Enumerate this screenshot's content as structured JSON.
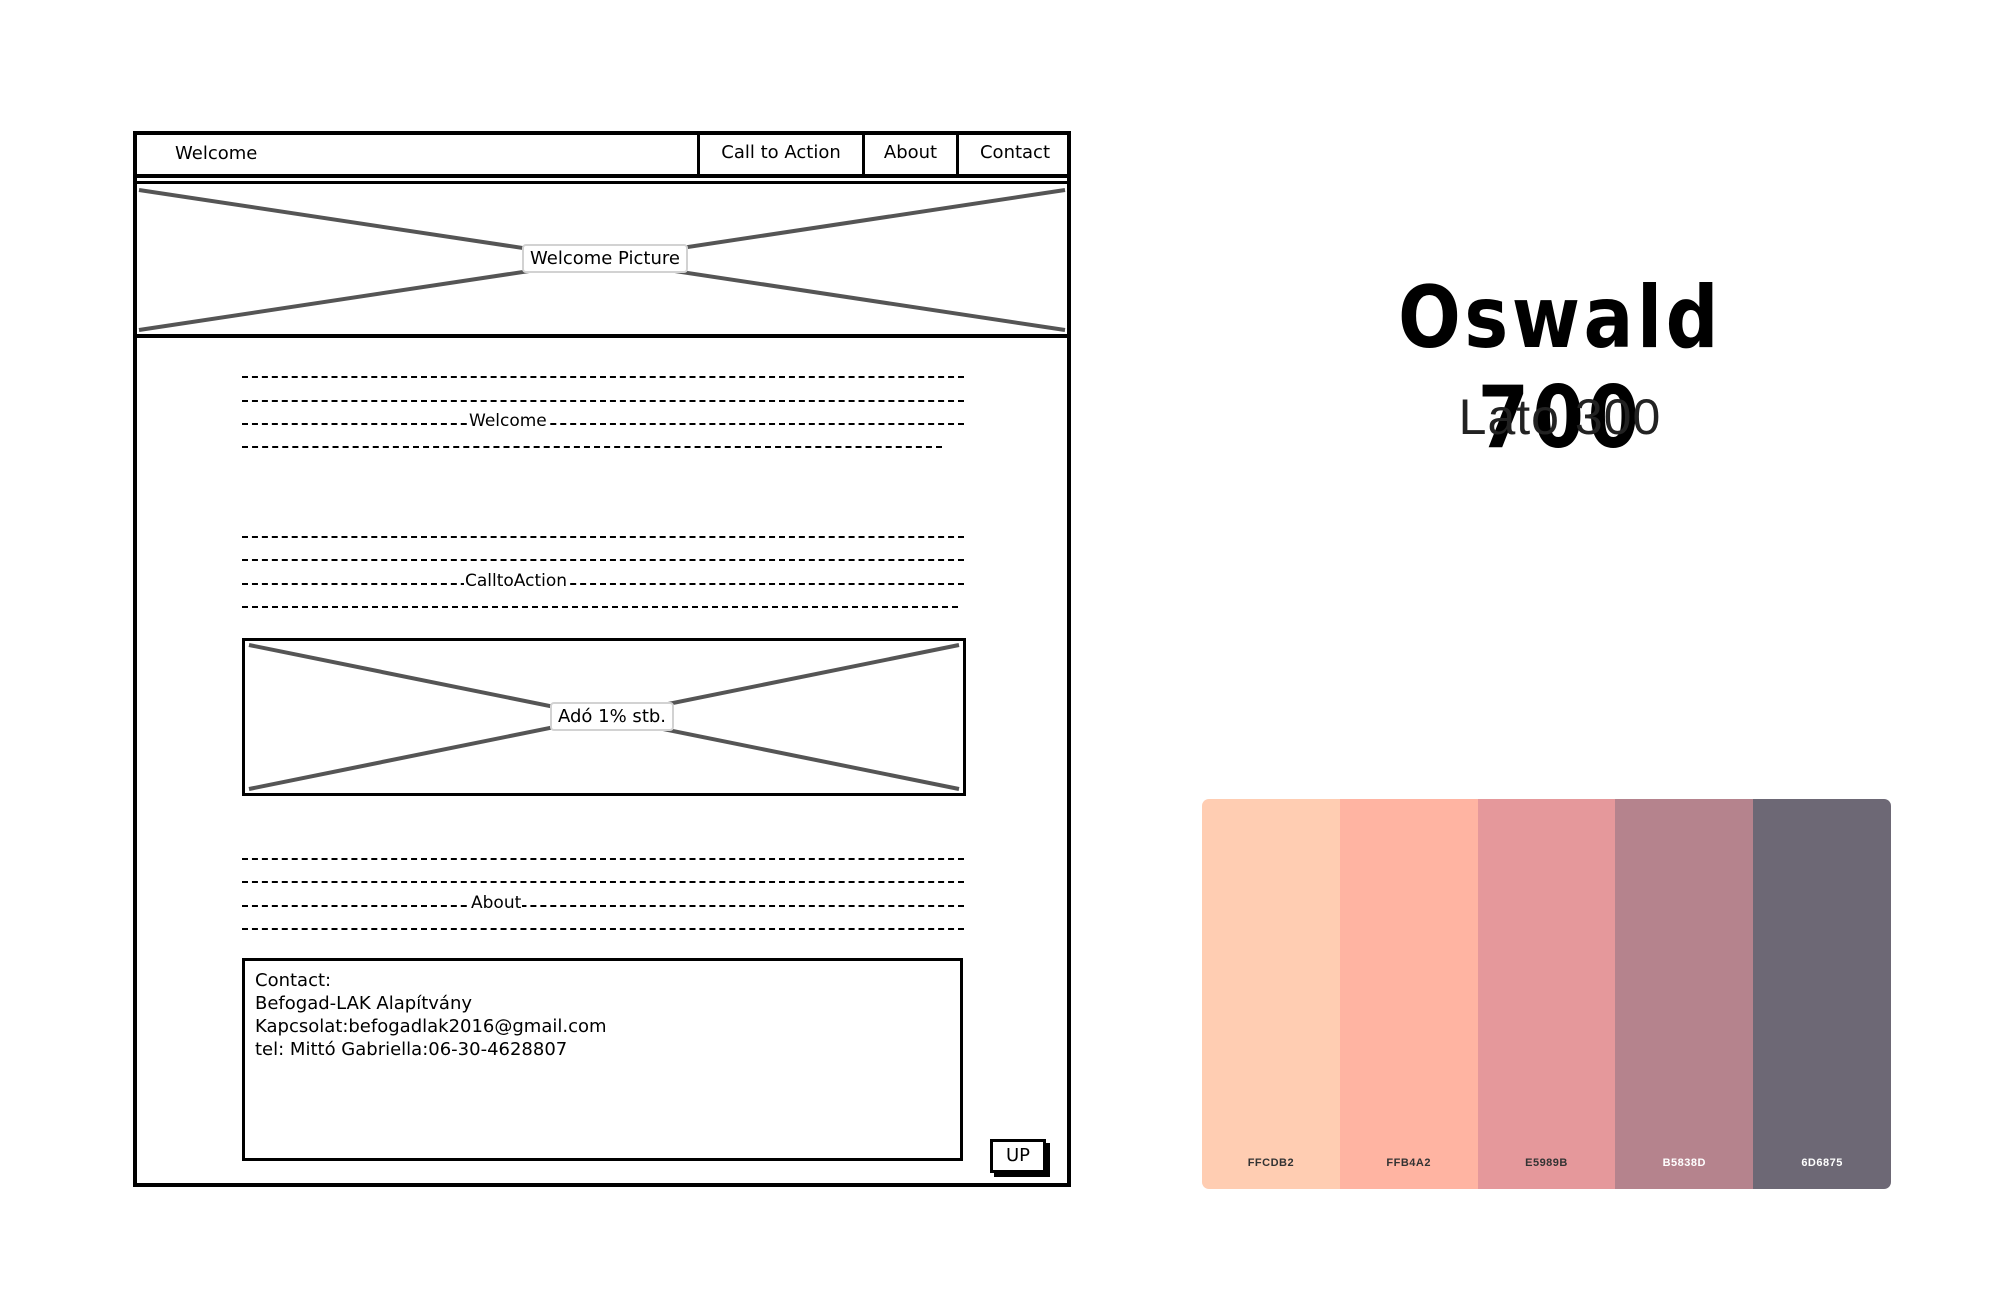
{
  "wireframe": {
    "nav": {
      "brand": "Welcome",
      "items": [
        {
          "label": "Call to Action"
        },
        {
          "label": "About"
        },
        {
          "label": "Contact"
        }
      ]
    },
    "hero_label": "Welcome Picture",
    "sections": {
      "welcome": "Welcome",
      "cta": "CalltoAction",
      "about": "About"
    },
    "cta_image_label": "Adó 1% stb.",
    "contact": {
      "line1": "Contact:",
      "line2": "Befogad-LAK Alapítvány",
      "line3": "Kapcsolat:befogadlak2016@gmail.com",
      "line4": "tel: Mittó Gabriella:06-30-4628807"
    },
    "up_button": "UP"
  },
  "typography": {
    "heading": "Oswald 700",
    "body": "Lato 300"
  },
  "palette": [
    {
      "hex": "#FFCDB2",
      "label": "FFCDB2",
      "text_color": "#333333"
    },
    {
      "hex": "#FFB4A2",
      "label": "FFB4A2",
      "text_color": "#333333"
    },
    {
      "hex": "#E5989B",
      "label": "E5989B",
      "text_color": "#333333"
    },
    {
      "hex": "#B5838D",
      "label": "B5838D",
      "text_color": "#ffffff"
    },
    {
      "hex": "#6D6875",
      "label": "6D6875",
      "text_color": "#ffffff"
    }
  ]
}
